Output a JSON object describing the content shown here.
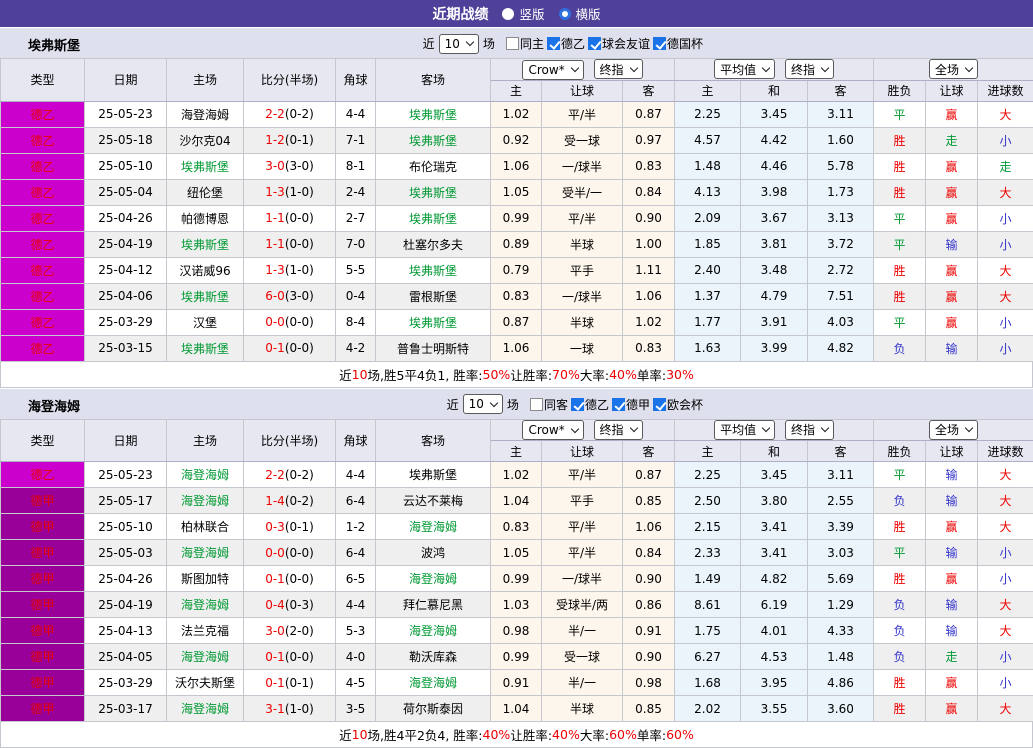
{
  "topbar": {
    "title": "近期战绩",
    "options": [
      {
        "label": "竖版",
        "selected": false
      },
      {
        "label": "横版",
        "selected": true
      }
    ]
  },
  "columns": {
    "type": "类型",
    "date": "日期",
    "home": "主场",
    "score": "比分(半场)",
    "corner": "角球",
    "away": "客场",
    "odds_home": "主",
    "odds_handicap": "让球",
    "odds_away": "客",
    "avg_home": "主",
    "avg_draw": "和",
    "avg_away": "客",
    "result_wdl": "胜负",
    "result_handicap": "让球",
    "result_goals": "进球数"
  },
  "controls": {
    "crow": "Crow*",
    "final1": "终指",
    "average": "平均值",
    "final2": "终指",
    "full": "全场"
  },
  "colors": {
    "topbar_bg": "#4F4199",
    "league_de2_bg": "#CC00CC",
    "league_de1_bg": "#990099",
    "league_text": "#E80000",
    "team_highlight_green": "#009933",
    "win_red": "#EE0000",
    "draw_green": "#009933",
    "lose_blue": "#3333CC",
    "odds_col_bg": "#FDF6EC",
    "avg_col_bg": "#EAF4FA",
    "checkbox_blue": "#1A73E8"
  },
  "tables": [
    {
      "team": "埃弗斯堡",
      "filter": {
        "near_label": "近",
        "match_count": "10",
        "games_label": "场",
        "checks": [
          [
            "同主",
            false
          ],
          [
            "德乙",
            true
          ],
          [
            "球会友谊",
            true
          ],
          [
            "德国杯",
            true
          ]
        ]
      },
      "rows": [
        {
          "lg": "德乙",
          "lgc": "de2",
          "date": "25-05-23",
          "home": "海登海姆",
          "hg": 0,
          "score": "2-2",
          "half": "(0-2)",
          "cn": "4-4",
          "away": "埃弗斯堡",
          "ag": 1,
          "o1": "1.02",
          "hc": "平/半",
          "o2": "0.87",
          "a1": "2.25",
          "a2": "3.45",
          "a3": "3.11",
          "r1": [
            "平",
            "g"
          ],
          "r2": [
            "赢",
            "r"
          ],
          "r3": [
            "大",
            "r"
          ]
        },
        {
          "lg": "德乙",
          "lgc": "de2",
          "date": "25-05-18",
          "home": "沙尔克04",
          "hg": 0,
          "score": "1-2",
          "half": "(0-1)",
          "cn": "7-1",
          "away": "埃弗斯堡",
          "ag": 1,
          "o1": "0.92",
          "hc": "受一球",
          "o2": "0.97",
          "a1": "4.57",
          "a2": "4.42",
          "a3": "1.60",
          "r1": [
            "胜",
            "r"
          ],
          "r2": [
            "走",
            "g"
          ],
          "r3": [
            "小",
            "b"
          ]
        },
        {
          "lg": "德乙",
          "lgc": "de2",
          "date": "25-05-10",
          "home": "埃弗斯堡",
          "hg": 1,
          "score": "3-0",
          "half": "(3-0)",
          "cn": "8-1",
          "away": "布伦瑞克",
          "ag": 0,
          "o1": "1.06",
          "hc": "一/球半",
          "o2": "0.83",
          "a1": "1.48",
          "a2": "4.46",
          "a3": "5.78",
          "r1": [
            "胜",
            "r"
          ],
          "r2": [
            "赢",
            "r"
          ],
          "r3": [
            "走",
            "g"
          ]
        },
        {
          "lg": "德乙",
          "lgc": "de2",
          "date": "25-05-04",
          "home": "纽伦堡",
          "hg": 0,
          "score": "1-3",
          "half": "(1-0)",
          "cn": "2-4",
          "away": "埃弗斯堡",
          "ag": 1,
          "o1": "1.05",
          "hc": "受半/一",
          "o2": "0.84",
          "a1": "4.13",
          "a2": "3.98",
          "a3": "1.73",
          "r1": [
            "胜",
            "r"
          ],
          "r2": [
            "赢",
            "r"
          ],
          "r3": [
            "大",
            "r"
          ]
        },
        {
          "lg": "德乙",
          "lgc": "de2",
          "date": "25-04-26",
          "home": "帕德博恩",
          "hg": 0,
          "score": "1-1",
          "half": "(0-0)",
          "cn": "2-7",
          "away": "埃弗斯堡",
          "ag": 1,
          "o1": "0.99",
          "hc": "平/半",
          "o2": "0.90",
          "a1": "2.09",
          "a2": "3.67",
          "a3": "3.13",
          "r1": [
            "平",
            "g"
          ],
          "r2": [
            "赢",
            "r"
          ],
          "r3": [
            "小",
            "b"
          ]
        },
        {
          "lg": "德乙",
          "lgc": "de2",
          "date": "25-04-19",
          "home": "埃弗斯堡",
          "hg": 1,
          "score": "1-1",
          "half": "(0-0)",
          "cn": "7-0",
          "away": "杜塞尔多夫",
          "ag": 0,
          "o1": "0.89",
          "hc": "半球",
          "o2": "1.00",
          "a1": "1.85",
          "a2": "3.81",
          "a3": "3.72",
          "r1": [
            "平",
            "g"
          ],
          "r2": [
            "输",
            "b"
          ],
          "r3": [
            "小",
            "b"
          ]
        },
        {
          "lg": "德乙",
          "lgc": "de2",
          "date": "25-04-12",
          "home": "汉诺威96",
          "hg": 0,
          "score": "1-3",
          "half": "(1-0)",
          "cn": "5-5",
          "away": "埃弗斯堡",
          "ag": 1,
          "o1": "0.79",
          "hc": "平手",
          "o2": "1.11",
          "a1": "2.40",
          "a2": "3.48",
          "a3": "2.72",
          "r1": [
            "胜",
            "r"
          ],
          "r2": [
            "赢",
            "r"
          ],
          "r3": [
            "大",
            "r"
          ]
        },
        {
          "lg": "德乙",
          "lgc": "de2",
          "date": "25-04-06",
          "home": "埃弗斯堡",
          "hg": 1,
          "score": "6-0",
          "half": "(3-0)",
          "cn": "0-4",
          "away": "雷根斯堡",
          "ag": 0,
          "o1": "0.83",
          "hc": "一/球半",
          "o2": "1.06",
          "a1": "1.37",
          "a2": "4.79",
          "a3": "7.51",
          "r1": [
            "胜",
            "r"
          ],
          "r2": [
            "赢",
            "r"
          ],
          "r3": [
            "大",
            "r"
          ]
        },
        {
          "lg": "德乙",
          "lgc": "de2",
          "date": "25-03-29",
          "home": "汉堡",
          "hg": 0,
          "score": "0-0",
          "half": "(0-0)",
          "cn": "8-4",
          "away": "埃弗斯堡",
          "ag": 1,
          "o1": "0.87",
          "hc": "半球",
          "o2": "1.02",
          "a1": "1.77",
          "a2": "3.91",
          "a3": "4.03",
          "r1": [
            "平",
            "g"
          ],
          "r2": [
            "赢",
            "r"
          ],
          "r3": [
            "小",
            "b"
          ]
        },
        {
          "lg": "德乙",
          "lgc": "de2",
          "date": "25-03-15",
          "home": "埃弗斯堡",
          "hg": 1,
          "score": "0-1",
          "half": "(0-0)",
          "cn": "4-2",
          "away": "普鲁士明斯特",
          "ag": 0,
          "o1": "1.06",
          "hc": "一球",
          "o2": "0.83",
          "a1": "1.63",
          "a2": "3.99",
          "a3": "4.82",
          "r1": [
            "负",
            "b"
          ],
          "r2": [
            "输",
            "b"
          ],
          "r3": [
            "小",
            "b"
          ]
        }
      ],
      "summary": [
        [
          "近",
          0
        ],
        [
          "10",
          1
        ],
        [
          "场,胜5平4负1, 胜率:",
          0
        ],
        [
          "50%",
          1
        ],
        [
          " 让胜率:",
          0
        ],
        [
          "70%",
          1
        ],
        [
          " 大率:",
          0
        ],
        [
          "40%",
          1
        ],
        [
          " 单率:",
          0
        ],
        [
          "30%",
          1
        ]
      ]
    },
    {
      "team": "海登海姆",
      "filter": {
        "near_label": "近",
        "match_count": "10",
        "games_label": "场",
        "checks": [
          [
            "同客",
            false
          ],
          [
            "德乙",
            true
          ],
          [
            "德甲",
            true
          ],
          [
            "欧会杯",
            true
          ]
        ]
      },
      "rows": [
        {
          "lg": "德乙",
          "lgc": "de2",
          "date": "25-05-23",
          "home": "海登海姆",
          "hg": 1,
          "score": "2-2",
          "half": "(0-2)",
          "cn": "4-4",
          "away": "埃弗斯堡",
          "ag": 0,
          "o1": "1.02",
          "hc": "平/半",
          "o2": "0.87",
          "a1": "2.25",
          "a2": "3.45",
          "a3": "3.11",
          "r1": [
            "平",
            "g"
          ],
          "r2": [
            "输",
            "b"
          ],
          "r3": [
            "大",
            "r"
          ]
        },
        {
          "lg": "德甲",
          "lgc": "de1",
          "date": "25-05-17",
          "home": "海登海姆",
          "hg": 1,
          "score": "1-4",
          "half": "(0-2)",
          "cn": "6-4",
          "away": "云达不莱梅",
          "ag": 0,
          "o1": "1.04",
          "hc": "平手",
          "o2": "0.85",
          "a1": "2.50",
          "a2": "3.80",
          "a3": "2.55",
          "r1": [
            "负",
            "b"
          ],
          "r2": [
            "输",
            "b"
          ],
          "r3": [
            "大",
            "r"
          ]
        },
        {
          "lg": "德甲",
          "lgc": "de1",
          "date": "25-05-10",
          "home": "柏林联合",
          "hg": 0,
          "score": "0-3",
          "half": "(0-1)",
          "cn": "1-2",
          "away": "海登海姆",
          "ag": 1,
          "o1": "0.83",
          "hc": "平/半",
          "o2": "1.06",
          "a1": "2.15",
          "a2": "3.41",
          "a3": "3.39",
          "r1": [
            "胜",
            "r"
          ],
          "r2": [
            "赢",
            "r"
          ],
          "r3": [
            "大",
            "r"
          ]
        },
        {
          "lg": "德甲",
          "lgc": "de1",
          "date": "25-05-03",
          "home": "海登海姆",
          "hg": 1,
          "score": "0-0",
          "half": "(0-0)",
          "cn": "6-4",
          "away": "波鸿",
          "ag": 0,
          "o1": "1.05",
          "hc": "平/半",
          "o2": "0.84",
          "a1": "2.33",
          "a2": "3.41",
          "a3": "3.03",
          "r1": [
            "平",
            "g"
          ],
          "r2": [
            "输",
            "b"
          ],
          "r3": [
            "小",
            "b"
          ]
        },
        {
          "lg": "德甲",
          "lgc": "de1",
          "date": "25-04-26",
          "home": "斯图加特",
          "hg": 0,
          "score": "0-1",
          "half": "(0-0)",
          "cn": "6-5",
          "away": "海登海姆",
          "ag": 1,
          "o1": "0.99",
          "hc": "一/球半",
          "o2": "0.90",
          "a1": "1.49",
          "a2": "4.82",
          "a3": "5.69",
          "r1": [
            "胜",
            "r"
          ],
          "r2": [
            "赢",
            "r"
          ],
          "r3": [
            "小",
            "b"
          ]
        },
        {
          "lg": "德甲",
          "lgc": "de1",
          "date": "25-04-19",
          "home": "海登海姆",
          "hg": 1,
          "score": "0-4",
          "half": "(0-3)",
          "cn": "4-4",
          "away": "拜仁慕尼黑",
          "ag": 0,
          "o1": "1.03",
          "hc": "受球半/两",
          "o2": "0.86",
          "a1": "8.61",
          "a2": "6.19",
          "a3": "1.29",
          "r1": [
            "负",
            "b"
          ],
          "r2": [
            "输",
            "b"
          ],
          "r3": [
            "大",
            "r"
          ]
        },
        {
          "lg": "德甲",
          "lgc": "de1",
          "date": "25-04-13",
          "home": "法兰克福",
          "hg": 0,
          "score": "3-0",
          "half": "(2-0)",
          "cn": "5-3",
          "away": "海登海姆",
          "ag": 1,
          "o1": "0.98",
          "hc": "半/一",
          "o2": "0.91",
          "a1": "1.75",
          "a2": "4.01",
          "a3": "4.33",
          "r1": [
            "负",
            "b"
          ],
          "r2": [
            "输",
            "b"
          ],
          "r3": [
            "大",
            "r"
          ]
        },
        {
          "lg": "德甲",
          "lgc": "de1",
          "date": "25-04-05",
          "home": "海登海姆",
          "hg": 1,
          "score": "0-1",
          "half": "(0-0)",
          "cn": "4-0",
          "away": "勒沃库森",
          "ag": 0,
          "o1": "0.99",
          "hc": "受一球",
          "o2": "0.90",
          "a1": "6.27",
          "a2": "4.53",
          "a3": "1.48",
          "r1": [
            "负",
            "b"
          ],
          "r2": [
            "走",
            "g"
          ],
          "r3": [
            "小",
            "b"
          ]
        },
        {
          "lg": "德甲",
          "lgc": "de1",
          "date": "25-03-29",
          "home": "沃尔夫斯堡",
          "hg": 0,
          "score": "0-1",
          "half": "(0-1)",
          "cn": "4-5",
          "away": "海登海姆",
          "ag": 1,
          "o1": "0.91",
          "hc": "半/一",
          "o2": "0.98",
          "a1": "1.68",
          "a2": "3.95",
          "a3": "4.86",
          "r1": [
            "胜",
            "r"
          ],
          "r2": [
            "赢",
            "r"
          ],
          "r3": [
            "小",
            "b"
          ]
        },
        {
          "lg": "德甲",
          "lgc": "de1",
          "date": "25-03-17",
          "home": "海登海姆",
          "hg": 1,
          "score": "3-1",
          "half": "(1-0)",
          "cn": "3-5",
          "away": "荷尔斯泰因",
          "ag": 0,
          "o1": "1.04",
          "hc": "半球",
          "o2": "0.85",
          "a1": "2.02",
          "a2": "3.55",
          "a3": "3.60",
          "r1": [
            "胜",
            "r"
          ],
          "r2": [
            "赢",
            "r"
          ],
          "r3": [
            "大",
            "r"
          ]
        }
      ],
      "summary": [
        [
          "近",
          0
        ],
        [
          "10",
          1
        ],
        [
          "场,胜4平2负4, 胜率:",
          0
        ],
        [
          "40%",
          1
        ],
        [
          " 让胜率:",
          0
        ],
        [
          "40%",
          1
        ],
        [
          " 大率:",
          0
        ],
        [
          "60%",
          1
        ],
        [
          " 单率:",
          0
        ],
        [
          "60%",
          1
        ]
      ]
    }
  ]
}
